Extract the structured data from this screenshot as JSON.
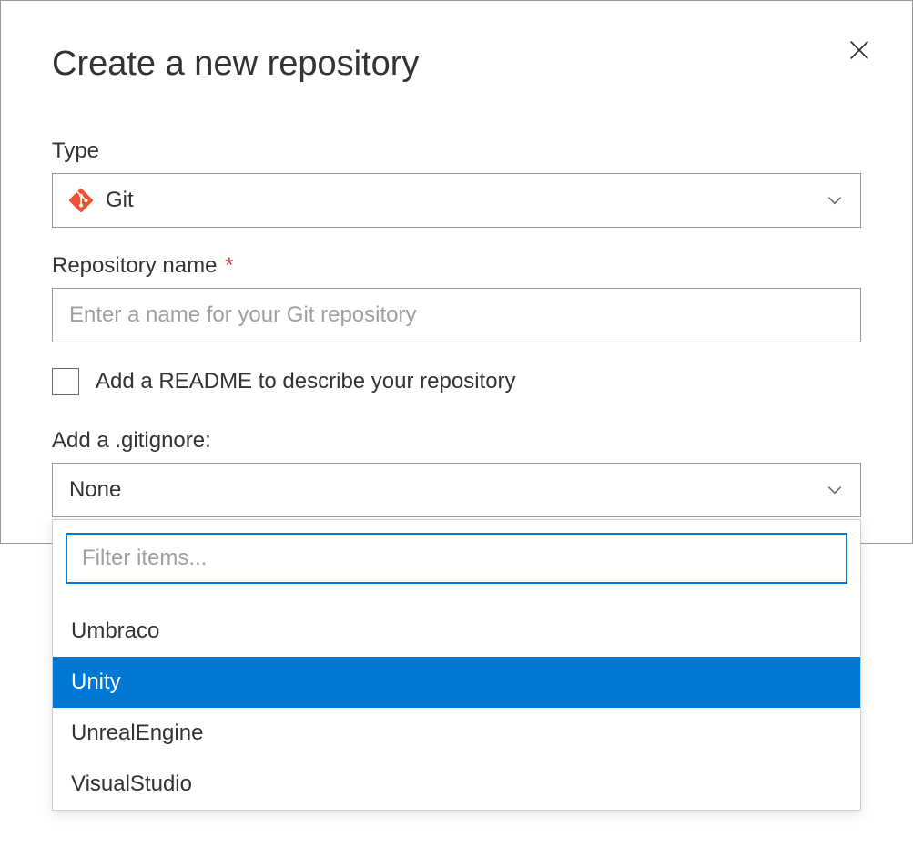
{
  "dialog": {
    "title": "Create a new repository"
  },
  "form": {
    "type_label": "Type",
    "type_value": "Git",
    "repo_name_label": "Repository name",
    "repo_name_placeholder": "Enter a name for your Git repository",
    "readme_label": "Add a README to describe your repository",
    "gitignore_label": "Add a .gitignore:",
    "gitignore_value": "None",
    "gitignore_filter_placeholder": "Filter items...",
    "gitignore_options": [
      {
        "label": "Umbraco",
        "highlighted": false
      },
      {
        "label": "Unity",
        "highlighted": true
      },
      {
        "label": "UnrealEngine",
        "highlighted": false
      },
      {
        "label": "VisualStudio",
        "highlighted": false
      }
    ]
  },
  "colors": {
    "accent": "#0078d4",
    "git_orange": "#f05133"
  }
}
